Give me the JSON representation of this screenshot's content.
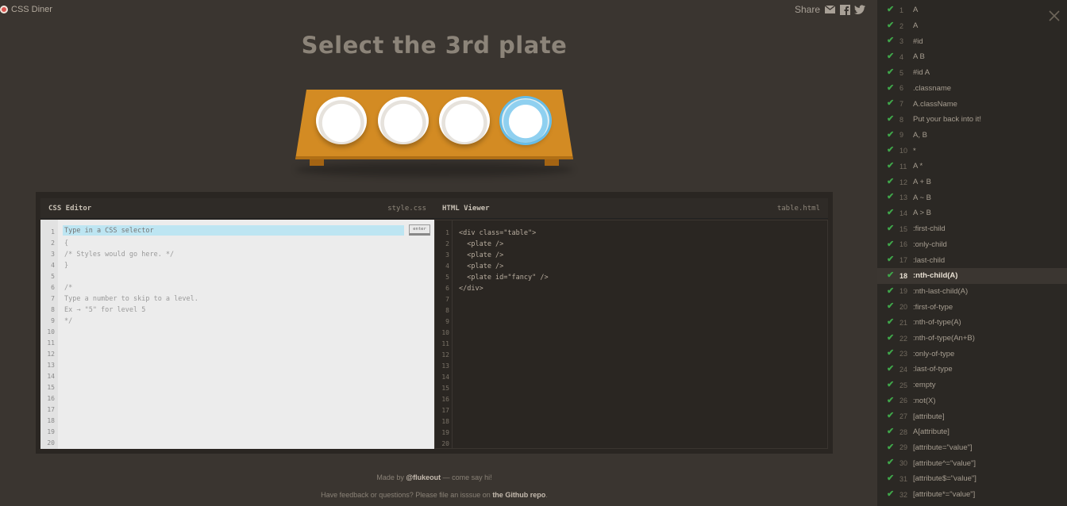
{
  "header": {
    "logo_text": "CSS Diner",
    "share_label": "Share",
    "share_icons": [
      "mail-icon",
      "facebook-icon",
      "twitter-icon"
    ]
  },
  "instruction": "Select the 3rd plate",
  "css_editor": {
    "title": "CSS Editor",
    "file": "style.css",
    "input_placeholder": "Type in a CSS selector",
    "enter_label": "enter",
    "code_lines": [
      "",
      "{",
      "/* Styles would go here. */",
      "}",
      "",
      "/*",
      "Type a number to skip to a level.",
      "Ex → \"5\" for level 5",
      "*/",
      "",
      "",
      "",
      "",
      "",
      "",
      "",
      "",
      "",
      "",
      ""
    ],
    "line_numbers": [
      "1",
      "2",
      "3",
      "4",
      "5",
      "6",
      "7",
      "8",
      "9",
      "10",
      "11",
      "12",
      "13",
      "14",
      "15",
      "16",
      "17",
      "18",
      "19",
      "20"
    ]
  },
  "html_viewer": {
    "title": "HTML Viewer",
    "file": "table.html",
    "code_lines": [
      "<div class=\"table\">",
      "  <plate />",
      "  <plate />",
      "  <plate />",
      "  <plate id=\"fancy\" />",
      "</div>",
      "",
      "",
      "",
      "",
      "",
      "",
      "",
      "",
      "",
      "",
      "",
      "",
      "",
      ""
    ],
    "line_numbers": [
      "1",
      "2",
      "3",
      "4",
      "5",
      "6",
      "7",
      "8",
      "9",
      "10",
      "11",
      "12",
      "13",
      "14",
      "15",
      "16",
      "17",
      "18",
      "19",
      "20"
    ]
  },
  "footer": {
    "line1_pre": "Made by ",
    "line1_link": "@flukeout",
    "line1_post": " — come say hi!",
    "line2_pre": "Have feedback or questions? Please file an isssue on ",
    "line2_link": "the Github repo",
    "line2_post": "."
  },
  "levels": [
    {
      "num": "1",
      "name": "A",
      "done": true
    },
    {
      "num": "2",
      "name": "A",
      "done": true
    },
    {
      "num": "3",
      "name": "#id",
      "done": true
    },
    {
      "num": "4",
      "name": "A B",
      "done": true
    },
    {
      "num": "5",
      "name": "#id A",
      "done": true
    },
    {
      "num": "6",
      "name": ".classname",
      "done": true
    },
    {
      "num": "7",
      "name": "A.className",
      "done": true
    },
    {
      "num": "8",
      "name": "Put your back into it!",
      "done": true
    },
    {
      "num": "9",
      "name": "A, B",
      "done": true
    },
    {
      "num": "10",
      "name": "*",
      "done": true
    },
    {
      "num": "11",
      "name": "A *",
      "done": true
    },
    {
      "num": "12",
      "name": "A + B",
      "done": true
    },
    {
      "num": "13",
      "name": "A ~ B",
      "done": true
    },
    {
      "num": "14",
      "name": "A > B",
      "done": true
    },
    {
      "num": "15",
      "name": ":first-child",
      "done": true
    },
    {
      "num": "16",
      "name": ":only-child",
      "done": true
    },
    {
      "num": "17",
      "name": ":last-child",
      "done": true
    },
    {
      "num": "18",
      "name": ":nth-child(A)",
      "done": true,
      "current": true
    },
    {
      "num": "19",
      "name": ":nth-last-child(A)",
      "done": true
    },
    {
      "num": "20",
      "name": ":first-of-type",
      "done": true
    },
    {
      "num": "21",
      "name": ":nth-of-type(A)",
      "done": true
    },
    {
      "num": "22",
      "name": ":nth-of-type(An+B)",
      "done": true
    },
    {
      "num": "23",
      "name": ":only-of-type",
      "done": true
    },
    {
      "num": "24",
      "name": ":last-of-type",
      "done": true
    },
    {
      "num": "25",
      "name": ":empty",
      "done": true
    },
    {
      "num": "26",
      "name": ":not(X)",
      "done": true
    },
    {
      "num": "27",
      "name": "[attribute]",
      "done": true
    },
    {
      "num": "28",
      "name": "A[attribute]",
      "done": true
    },
    {
      "num": "29",
      "name": "[attribute=\"value\"]",
      "done": true
    },
    {
      "num": "30",
      "name": "[attribute^=\"value\"]",
      "done": true
    },
    {
      "num": "31",
      "name": "[attribute$=\"value\"]",
      "done": true
    },
    {
      "num": "32",
      "name": "[attribute*=\"value\"]",
      "done": true
    }
  ],
  "colors": {
    "background": "#3a3530",
    "table": "#d38b23",
    "check": "#3fa64a",
    "fancy_ring": "#66bde8"
  }
}
